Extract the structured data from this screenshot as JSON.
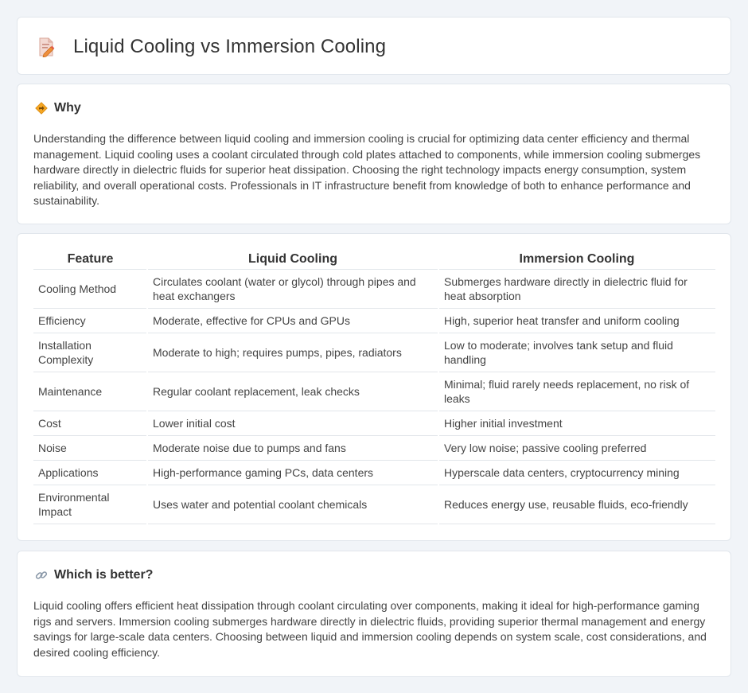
{
  "header": {
    "title": "Liquid Cooling vs Immersion Cooling",
    "icon": "document-edit-icon"
  },
  "why": {
    "heading": "Why",
    "icon": "diamond-arrow-icon",
    "text": "Understanding the difference between liquid cooling and immersion cooling is crucial for optimizing data center efficiency and thermal management. Liquid cooling uses a coolant circulated through cold plates attached to components, while immersion cooling submerges hardware directly in dielectric fluids for superior heat dissipation. Choosing the right technology impacts energy consumption, system reliability, and overall operational costs. Professionals in IT infrastructure benefit from knowledge of both to enhance performance and sustainability."
  },
  "table": {
    "headers": [
      "Feature",
      "Liquid Cooling",
      "Immersion Cooling"
    ],
    "rows": [
      [
        "Cooling Method",
        "Circulates coolant (water or glycol) through pipes and heat exchangers",
        "Submerges hardware directly in dielectric fluid for heat absorption"
      ],
      [
        "Efficiency",
        "Moderate, effective for CPUs and GPUs",
        "High, superior heat transfer and uniform cooling"
      ],
      [
        "Installation Complexity",
        "Moderate to high; requires pumps, pipes, radiators",
        "Low to moderate; involves tank setup and fluid handling"
      ],
      [
        "Maintenance",
        "Regular coolant replacement, leak checks",
        "Minimal; fluid rarely needs replacement, no risk of leaks"
      ],
      [
        "Cost",
        "Lower initial cost",
        "Higher initial investment"
      ],
      [
        "Noise",
        "Moderate noise due to pumps and fans",
        "Very low noise; passive cooling preferred"
      ],
      [
        "Applications",
        "High-performance gaming PCs, data centers",
        "Hyperscale data centers, cryptocurrency mining"
      ],
      [
        "Environmental Impact",
        "Uses water and potential coolant chemicals",
        "Reduces energy use, reusable fluids, eco-friendly"
      ]
    ]
  },
  "better": {
    "heading": "Which is better?",
    "icon": "link-icon",
    "text": "Liquid cooling offers efficient heat dissipation through coolant circulating over components, making it ideal for high-performance gaming rigs and servers. Immersion cooling submerges hardware directly in dielectric fluids, providing superior thermal management and energy savings for large-scale data centers. Choosing between liquid and immersion cooling depends on system scale, cost considerations, and desired cooling efficiency."
  },
  "colors": {
    "background": "#f1f4f8",
    "card": "#ffffff",
    "border": "#e1e6ec",
    "text": "#444444"
  }
}
